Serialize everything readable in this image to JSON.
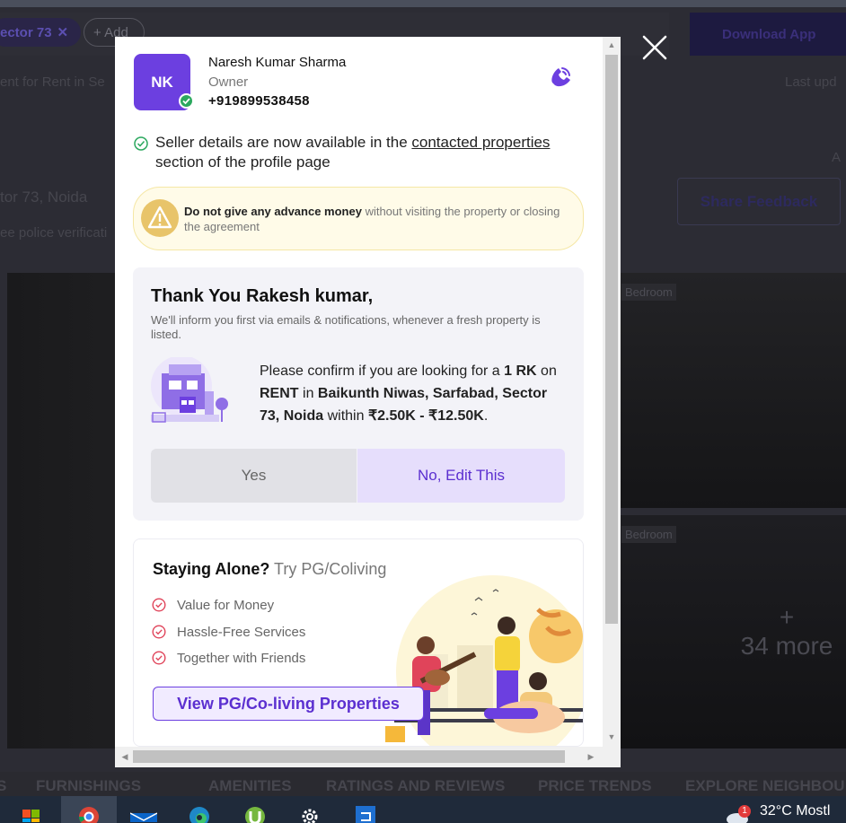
{
  "background": {
    "chips": {
      "sector": "ector 73",
      "add": "+ Add"
    },
    "download_app": "Download App",
    "breadcrumb_text": "ent for Rent in Se",
    "last_updated": "Last upd",
    "location": "tor 73, Noida",
    "police_text": "ee police verificati",
    "right_edge": "A",
    "share_feedback": "Share Feedback",
    "photo_tag_1": "Bedroom",
    "photo_tag_2": "Bedroom",
    "more_plus": "+",
    "more_photos": "34 more",
    "tabs": [
      "S",
      "FURNISHINGS",
      "AMENITIES",
      "RATINGS AND REVIEWS",
      "PRICE TRENDS",
      "EXPLORE NEIGHBOU"
    ]
  },
  "taskbar": {
    "icons": [
      "windows-start-icon",
      "chrome-icon",
      "mail-icon",
      "edge-icon",
      "utorrent-icon",
      "settings-icon",
      "app-icon"
    ],
    "weather_badge": "1",
    "weather": "32°C  Mostl"
  },
  "modal": {
    "owner": {
      "initials": "NK",
      "name": "Naresh Kumar Sharma",
      "role": "Owner",
      "phone": "+919899538458"
    },
    "info": {
      "prefix": "Seller details are now available in the ",
      "link": "contacted properties",
      "suffix": " section of the profile page"
    },
    "warning": {
      "bold": "Do not give any advance money",
      "rest": " without visiting the property or closing the agreement"
    },
    "thanks": {
      "title": "Thank You Rakesh kumar,",
      "subtitle": "We'll inform you first via emails & notifications, whenever a fresh property is listed.",
      "confirm_prefix": "Please confirm if you are looking for a ",
      "bhk": "1 RK",
      "on": " on ",
      "mode": "RENT",
      "in": " in ",
      "location": "Baikunth Niwas, Sarfabad, Sector 73, Noida",
      "within": " within ",
      "budget": "₹2.50K - ₹12.50K",
      "end": ".",
      "yes_label": "Yes",
      "no_label": "No, Edit This"
    },
    "pg": {
      "title_bold": "Staying Alone?",
      "title_light": " Try PG/Coliving",
      "benefits": [
        "Value for Money",
        "Hassle-Free Services",
        "Together with Friends"
      ],
      "button_label": "View PG/Co-living Properties"
    }
  },
  "colors": {
    "brand_purple": "#6c3fe0",
    "verified_green": "#2ba85e",
    "warning_yellow": "#e8c46a",
    "check_red": "#e0445a"
  }
}
